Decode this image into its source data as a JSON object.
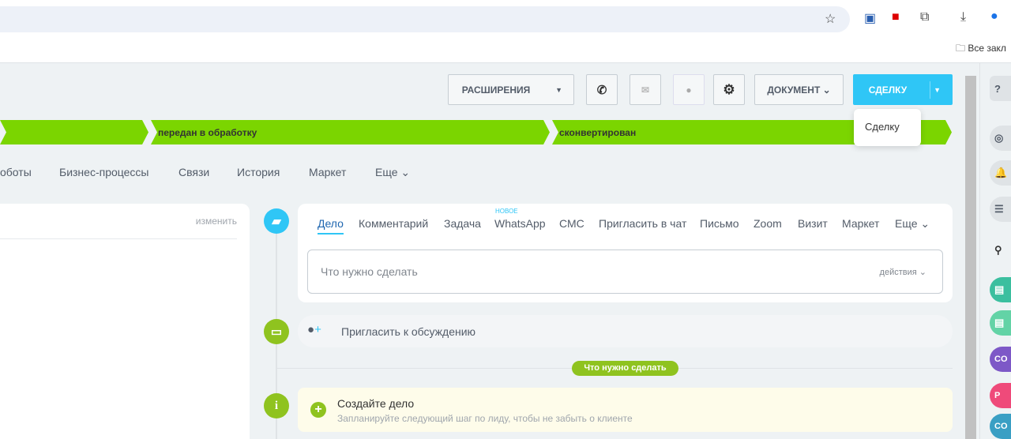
{
  "browser": {
    "bookmarks_label": "Все закл"
  },
  "toolbar": {
    "extensions": "РАСШИРЕНИЯ",
    "document": "ДОКУМЕНТ",
    "deal": "СДЕЛКУ",
    "dropdown_item": "Сделку"
  },
  "stages": [
    "передан в обработку",
    "сконвертирован"
  ],
  "tabs": [
    "оботы",
    "Бизнес-процессы",
    "Связи",
    "История",
    "Маркет",
    "Еще"
  ],
  "left_panel": {
    "edit": "изменить"
  },
  "activity": {
    "tabs": [
      "Дело",
      "Комментарий",
      "Задача",
      "WhatsApp",
      "СМС",
      "Пригласить в чат",
      "Письмо",
      "Zoom",
      "Визит",
      "Маркет",
      "Еще"
    ],
    "new_badge": "НОВОЕ",
    "placeholder": "Что нужно сделать",
    "actions": "действия"
  },
  "invite": "Пригласить к обсуждению",
  "divider_badge": "Что нужно сделать",
  "create": {
    "title": "Создайте дело",
    "subtitle": "Запланируйте следующий шаг по лиду, чтобы не забыть о клиенте"
  },
  "right_panel": {
    "avatars": [
      "CO",
      "P",
      "CO"
    ]
  },
  "colors": {
    "green": "#7bd500",
    "blue": "#2fc6f6"
  }
}
